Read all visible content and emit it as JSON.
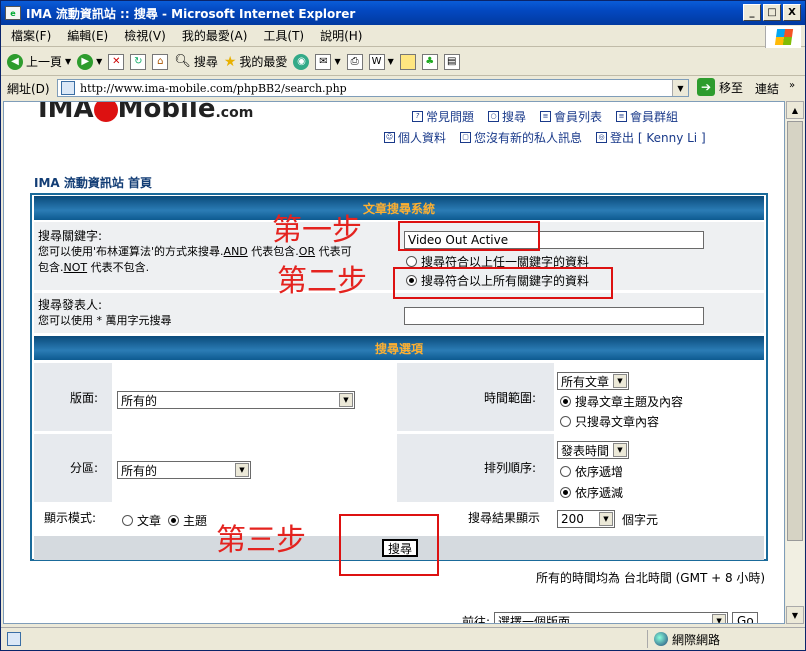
{
  "window": {
    "title": "IMA 流動資訊站 :: 搜尋 - Microsoft Internet Explorer",
    "min": "_",
    "max": "□",
    "close": "X"
  },
  "menu": [
    "檔案(F)",
    "編輯(E)",
    "檢視(V)",
    "我的最愛(A)",
    "工具(T)",
    "說明(H)"
  ],
  "toolbar": {
    "back": "上一頁",
    "search": "搜尋",
    "favorites": "我的最愛"
  },
  "address": {
    "label": "網址(D)",
    "url": "http://www.ima-mobile.com/phpBB2/search.php",
    "go": "移至",
    "links": "連結"
  },
  "site": {
    "logo": "IMA Mobile",
    "logo_suffix": ".com"
  },
  "toplinks": {
    "faq": "常見問題",
    "search": "搜尋",
    "members": "會員列表",
    "groups": "會員群組",
    "profile": "個人資料",
    "pm": "您沒有新的私人訊息",
    "logout": "登出 [ Kenny Li ]"
  },
  "nav": {
    "index": "IMA 流動資訊站 首頁"
  },
  "form": {
    "header": "文章搜尋系統",
    "keyword_label": "搜尋關鍵字:",
    "keyword_help_1": "您可以使用'布林運算法'的方式來搜尋.",
    "keyword_and": "AND",
    "keyword_help_2": "代表包含.",
    "keyword_or": "OR",
    "keyword_help_3": "代表可",
    "keyword_help_4": "包含.",
    "keyword_not": "NOT",
    "keyword_help_5": "代表不包含.",
    "keyword_value": "Video Out Active",
    "opt_any": "搜尋符合以上任一關鍵字的資料",
    "opt_all": "搜尋符合以上所有關鍵字的資料",
    "author_label": "搜尋發表人:",
    "author_help": "您可以使用 * 萬用字元搜尋",
    "author_value": ""
  },
  "options": {
    "header": "搜尋選項",
    "forum_label": "版面:",
    "forum_value": "所有的",
    "time_label": "時間範圍:",
    "time_value": "所有文章",
    "time_opt1": "搜尋文章主題及內容",
    "time_opt2": "只搜尋文章內容",
    "cat_label": "分區:",
    "cat_value": "所有的",
    "sort_label": "排列順序:",
    "sort_value": "發表時間",
    "sort_asc": "依序遞增",
    "sort_desc": "依序遞減",
    "display_label": "顯示模式:",
    "display_posts": "文章",
    "display_topics": "主題",
    "results_label": "搜尋結果顯示",
    "results_value": "200",
    "results_unit": "個字元",
    "submit": "搜尋"
  },
  "annotations": {
    "step1": "第一步",
    "step2": "第二步",
    "step3": "第三步"
  },
  "footer": {
    "timezone": "所有的時間均為 台北時間 (GMT + 8 小時)",
    "jump_label": "前往:",
    "jump_value": "選擇一個版面",
    "jump_go": "Go"
  },
  "status": {
    "zone": "網際網路"
  },
  "colors": {
    "annotation": "#e4231f",
    "header_text": "#ffb030"
  }
}
